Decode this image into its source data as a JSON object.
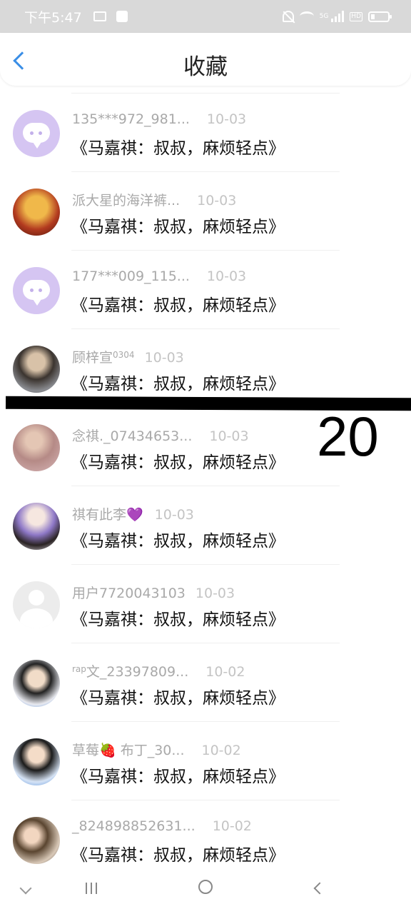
{
  "status_bar": {
    "time": "下午5:47",
    "network": "5G",
    "hd": "HD",
    "icons": [
      "folder-icon",
      "bag-icon",
      "mute-icon",
      "wifi-icon",
      "signal-icon",
      "battery-icon"
    ]
  },
  "header": {
    "title": "收藏",
    "back_icon": "back-chevron-icon"
  },
  "items": [
    {
      "name": "135***972_981...",
      "date": "10-03",
      "message": "《马嘉祺：叔叔，麻烦轻点》"
    },
    {
      "name": "派大星的海洋裤...",
      "date": "10-03",
      "message": "《马嘉祺：叔叔，麻烦轻点》"
    },
    {
      "name": "177***009_115...",
      "date": "10-03",
      "message": "《马嘉祺：叔叔，麻烦轻点》"
    },
    {
      "name": "顾梓宣",
      "name_sup": "0304",
      "date": "10-03",
      "message": "《马嘉祺：叔叔，麻烦轻点》"
    },
    {
      "name": "念祺._07434653...",
      "date": "10-03",
      "message": "《马嘉祺：叔叔，麻烦轻点》"
    },
    {
      "name": "祺有此李",
      "name_emoji": "💜",
      "date": "10-03",
      "message": "《马嘉祺：叔叔，麻烦轻点》"
    },
    {
      "name": "用户7720043103",
      "date": "10-03",
      "message": "《马嘉祺：叔叔，麻烦轻点》"
    },
    {
      "name_sup": "rap",
      "name": "文_23397809...",
      "date": "10-02",
      "message": "《马嘉祺：叔叔，麻烦轻点》"
    },
    {
      "name": "草莓🍓 布丁_30...",
      "date": "10-02",
      "message": "《马嘉祺：叔叔，麻烦轻点》"
    },
    {
      "name": "_824898852631...",
      "date": "10-02",
      "message": "《马嘉祺：叔叔，麻烦轻点》"
    }
  ],
  "overlay": {
    "number": "20"
  },
  "colors": {
    "accent": "#3a8ee6",
    "name_gray": "#a9a9a9",
    "bot_avatar": "#d5c5f2"
  }
}
